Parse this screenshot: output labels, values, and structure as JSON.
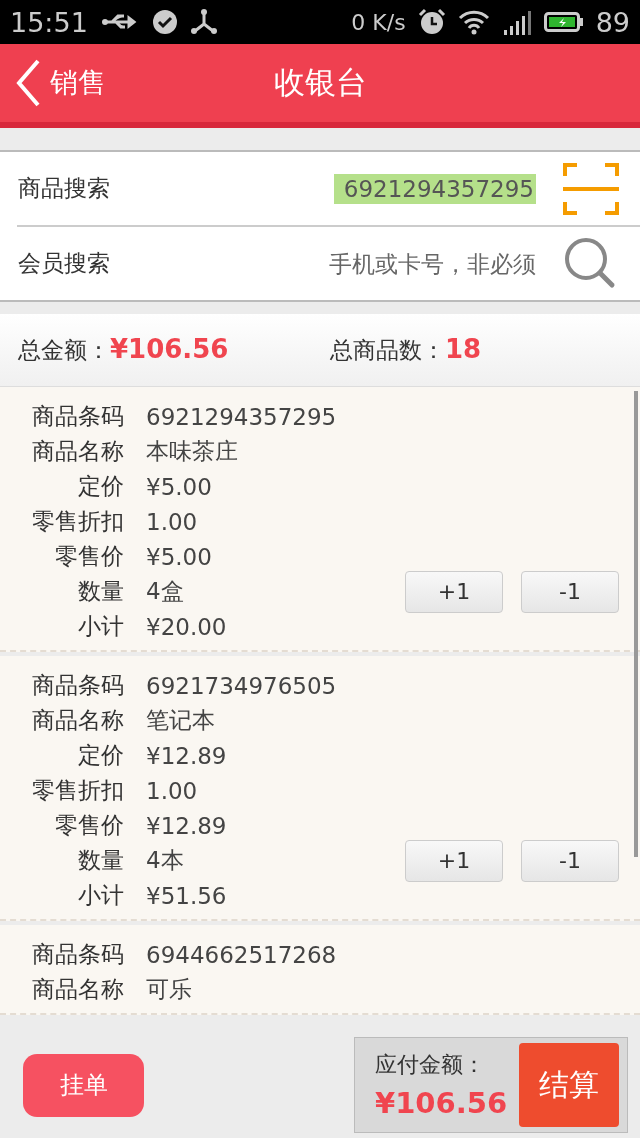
{
  "status_bar": {
    "time": "15:51",
    "net_speed": "0 K/s",
    "battery": "89"
  },
  "header": {
    "back": "销售",
    "title": "收银台"
  },
  "search": [
    {
      "kind": "scan",
      "label": "商品搜索",
      "value": "6921294357295",
      "highlighted": true
    },
    {
      "kind": "search",
      "label": "会员搜索",
      "placeholder": "手机或卡号，非必须"
    }
  ],
  "totals": {
    "amount_label": "总金额：",
    "amount": "¥106.56",
    "count_label": "总商品数：",
    "count": "18"
  },
  "items": [
    {
      "fields": [
        {
          "label": "商品条码",
          "value": "6921294357295"
        },
        {
          "label": "商品名称",
          "value": "本味茶庄"
        },
        {
          "label": "定价",
          "value": "¥5.00"
        },
        {
          "label": "零售折扣",
          "value": "1.00"
        },
        {
          "label": "零售价",
          "value": "¥5.00"
        },
        {
          "label": "数量",
          "value": "4盒",
          "buttons": [
            "+1",
            "-1"
          ]
        },
        {
          "label": "小计",
          "value": "¥20.00"
        }
      ]
    },
    {
      "fields": [
        {
          "label": "商品条码",
          "value": "6921734976505"
        },
        {
          "label": "商品名称",
          "value": "笔记本"
        },
        {
          "label": "定价",
          "value": "¥12.89"
        },
        {
          "label": "零售折扣",
          "value": "1.00"
        },
        {
          "label": "零售价",
          "value": "¥12.89"
        },
        {
          "label": "数量",
          "value": "4本",
          "buttons": [
            "+1",
            "-1"
          ]
        },
        {
          "label": "小计",
          "value": "¥51.56"
        }
      ]
    },
    {
      "fields": [
        {
          "label": "商品条码",
          "value": "6944662517268"
        },
        {
          "label": "商品名称",
          "value": "可乐"
        }
      ]
    }
  ],
  "footer": {
    "hold_button": "挂单",
    "due_label": "应付金额：",
    "due_amount": "¥106.56",
    "checkout_button": "结算"
  }
}
